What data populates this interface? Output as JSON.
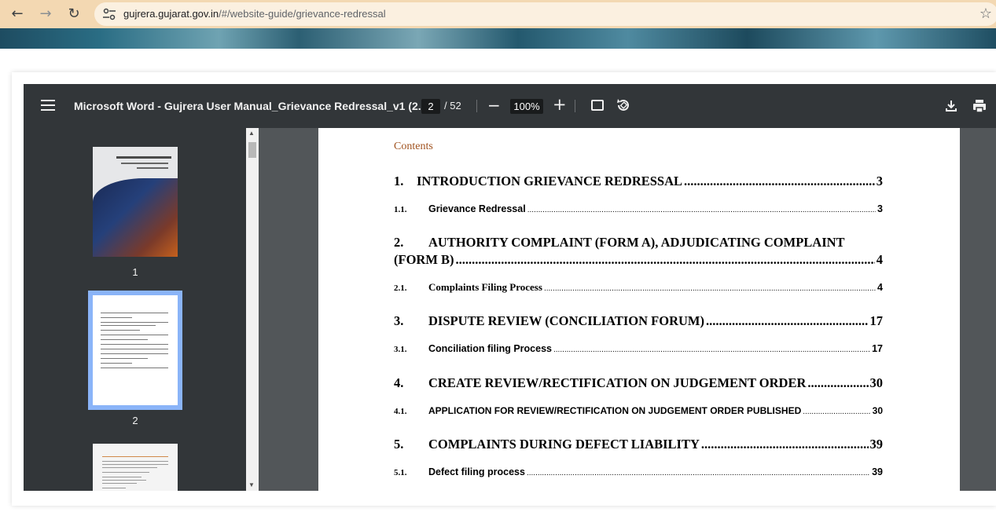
{
  "browser": {
    "url_host": "gujrera.gujarat.gov.in",
    "url_path": "/#/website-guide/grievance-redressal"
  },
  "viewer": {
    "title": "Microsoft Word - Gujrera User Manual_Grievance Redressal_v1 (2...",
    "current_page": "2",
    "total_pages": "/ 52",
    "zoom": "100%"
  },
  "thumbnails": [
    {
      "label": "1"
    },
    {
      "label": "2"
    }
  ],
  "page": {
    "contents_heading": "Contents",
    "toc": [
      {
        "num": "1.",
        "text": "INTRODUCTION GRIEVANCE REDRESSAL",
        "page": "3"
      },
      {
        "num": "1.1.",
        "text": "Grievance Redressal",
        "page": "3"
      },
      {
        "num": "2.",
        "text": "AUTHORITY COMPLAINT (FORM A), ADJUDICATING COMPLAINT",
        "text2": "(FORM B)",
        "page": "4"
      },
      {
        "num": "2.1.",
        "text": "Complaints Filing Process",
        "page": "4"
      },
      {
        "num": "3.",
        "text": "DISPUTE REVIEW (CONCILIATION FORUM)",
        "page": "17"
      },
      {
        "num": "3.1.",
        "text": "Conciliation filing Process",
        "page": "17"
      },
      {
        "num": "4.",
        "text": "CREATE REVIEW/RECTIFICATION ON JUDGEMENT ORDER",
        "page": "30"
      },
      {
        "num": "4.1.",
        "text": "APPLICATION FOR REVIEW/RECTIFICATION ON JUDGEMENT ORDER PUBLISHED",
        "page": "30"
      },
      {
        "num": "5.",
        "text": "COMPLAINTS DURING DEFECT LIABILITY",
        "page": "39"
      },
      {
        "num": "5.1.",
        "text": "Defect filing process",
        "page": "39"
      }
    ]
  }
}
